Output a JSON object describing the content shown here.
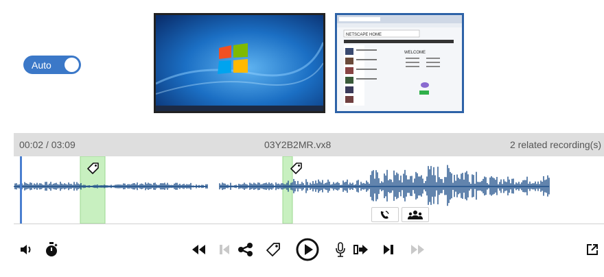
{
  "toggle": {
    "label": "Auto",
    "state": "on",
    "color": "#3b78c8"
  },
  "thumbnails": [
    {
      "name": "desktop-thumbnail",
      "selected": true
    },
    {
      "name": "browser-thumbnail",
      "selected": false,
      "page_heading": "NETSCAPE HOME",
      "page_subheading": "WELCOME"
    }
  ],
  "info": {
    "time": "00:02 / 03:09",
    "filename": "03Y2B2MR.vx8",
    "related": "2 related recording(s)"
  },
  "timeline": {
    "waveform_color": "#1f4f8a",
    "marker_color": "#c8f0c0",
    "playhead_color": "#4a7fd0",
    "tags": 2
  },
  "colors": {
    "accent": "#3b78c8",
    "icon": "#111111",
    "disabled_icon": "#c9c9c9"
  },
  "controls": {
    "left": [
      "volume-icon",
      "stopwatch-icon"
    ],
    "center": [
      "rewind-icon",
      "skip-back-icon",
      "share-icon",
      "tag-icon",
      "play-icon",
      "microphone-icon",
      "forward-step-icon",
      "skip-forward-icon",
      "fast-forward-icon"
    ],
    "right": [
      "popout-icon"
    ]
  }
}
